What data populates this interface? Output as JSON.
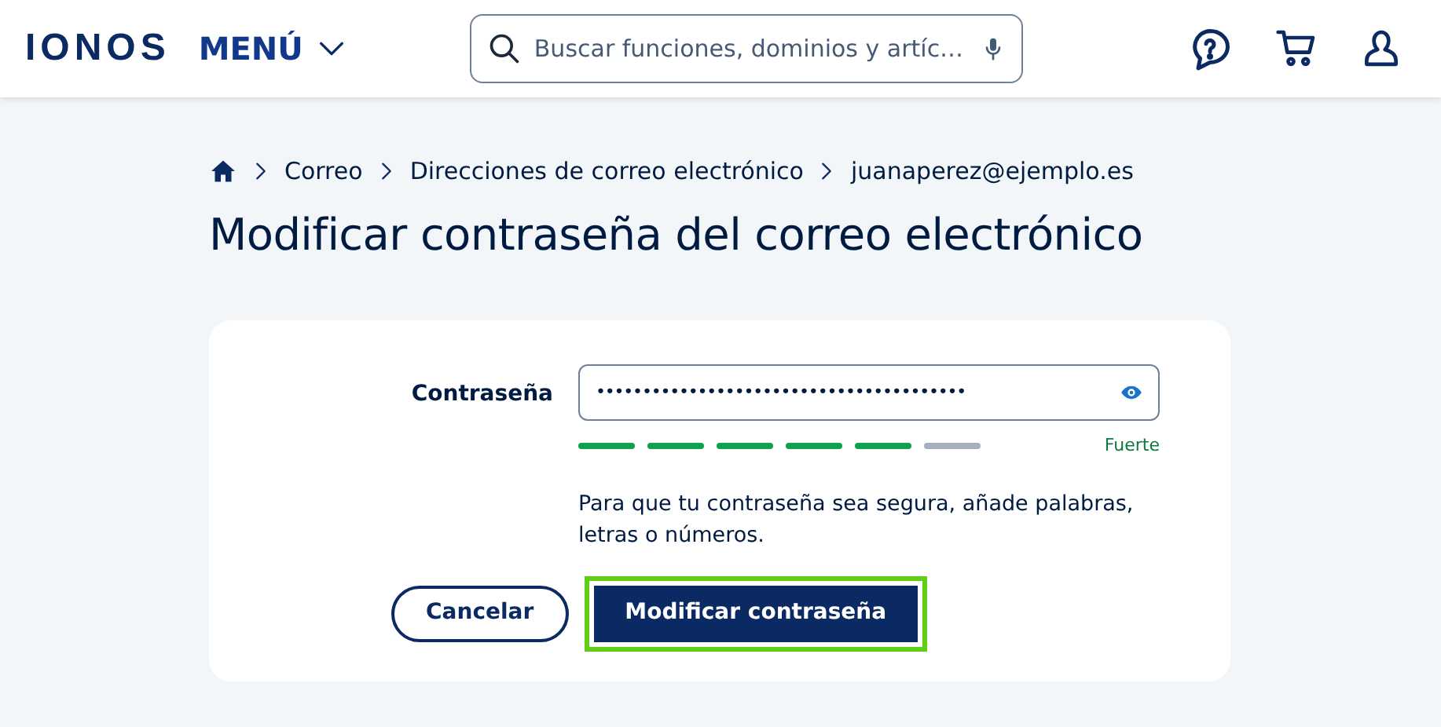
{
  "header": {
    "logo": "IONOS",
    "menu": "MENÚ",
    "search": {
      "placeholder": "Buscar funciones, dominios y artíc…"
    }
  },
  "breadcrumb": [
    "Correo",
    "Direcciones de correo electrónico",
    "juanaperez@ejemplo.es"
  ],
  "title": "Modificar contraseña del correo electrónico",
  "form": {
    "label": "Contraseña",
    "value": "••••••••••••••••••••••••••••••••••••••••",
    "strength": [
      {
        "filled": true
      },
      {
        "filled": true
      },
      {
        "filled": true
      },
      {
        "filled": true
      },
      {
        "filled": true
      },
      {
        "filled": false
      }
    ],
    "strength_label": "Fuerte",
    "hint": "Para que tu contraseña sea segura, añade palabras, letras o números."
  },
  "buttons": [
    {
      "label": "Cancelar",
      "kind": "secondary",
      "highlighted": false
    },
    {
      "label": "Modificar contraseña",
      "kind": "primary",
      "highlighted": true
    }
  ]
}
